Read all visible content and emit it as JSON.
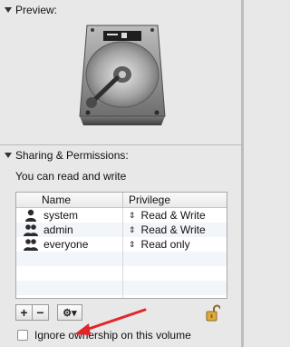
{
  "preview": {
    "title": "Preview:"
  },
  "sharing": {
    "title": "Sharing & Permissions:",
    "subtitle": "You can read and write",
    "columns": {
      "name": "Name",
      "privilege": "Privilege"
    },
    "rows": [
      {
        "name": "system",
        "privilege": "Read & Write",
        "icon": "single-user-icon"
      },
      {
        "name": "admin",
        "privilege": "Read & Write",
        "icon": "group-icon"
      },
      {
        "name": "everyone",
        "privilege": "Read only",
        "icon": "group-icon"
      }
    ]
  },
  "toolbar": {
    "add_label": "+",
    "remove_label": "−",
    "action_label": "⚙▾"
  },
  "ignore_ownership": {
    "label": "Ignore ownership on this volume",
    "checked": false
  },
  "colors": {
    "arrow": "#e0262a",
    "background": "#e8e8e8"
  }
}
